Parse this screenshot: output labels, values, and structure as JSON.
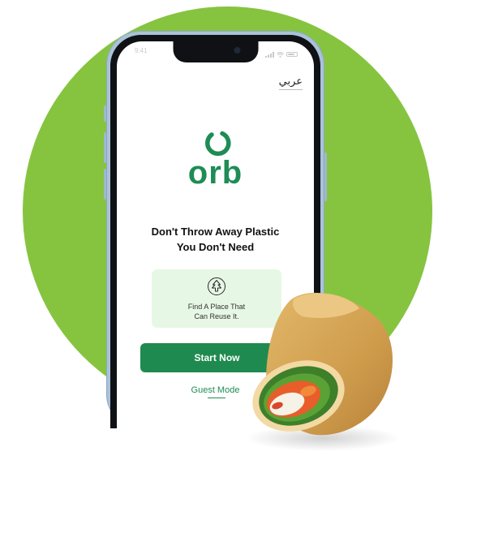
{
  "status_bar": {
    "time": "9:41"
  },
  "language_toggle": {
    "label": "عربي"
  },
  "brand": {
    "name": "orb",
    "color": "#1e8c55"
  },
  "headline": {
    "line1": "Don't Throw Away Plastic",
    "line2": "You Don't Need"
  },
  "feature_card": {
    "icon": "tree-icon",
    "line1": "Find A Place That",
    "line2": "Can Reuse It."
  },
  "actions": {
    "start_label": "Start Now",
    "guest_label": "Guest Mode"
  },
  "colors": {
    "background_circle": "#86c440",
    "primary_button": "#1f8a4f",
    "card_bg": "#e7f7e5"
  },
  "illustration": {
    "icon": "food-wrap-icon"
  }
}
